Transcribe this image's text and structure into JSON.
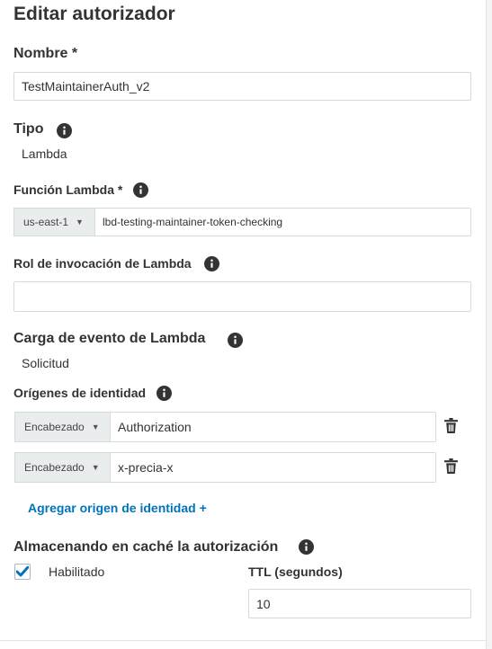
{
  "page": {
    "title": "Editar autorizador"
  },
  "nombre": {
    "label": "Nombre *",
    "value": "TestMaintainerAuth_v2"
  },
  "tipo": {
    "label": "Tipo",
    "value": "Lambda"
  },
  "funcion_lambda": {
    "label": "Función Lambda *",
    "region": "us-east-1",
    "value": "lbd-testing-maintainer-token-checking"
  },
  "rol_invocacion": {
    "label": "Rol de invocación de Lambda",
    "value": ""
  },
  "carga_evento": {
    "label": "Carga de evento de Lambda",
    "value": "Solicitud"
  },
  "origenes_identidad": {
    "label": "Orígenes de identidad",
    "rows": [
      {
        "type": "Encabezado",
        "value": "Authorization"
      },
      {
        "type": "Encabezado",
        "value": "x-precia-x"
      }
    ],
    "add_link": "Agregar origen de identidad +"
  },
  "cache": {
    "label": "Almacenando en caché la autorización",
    "enabled_label": "Habilitado",
    "enabled": true,
    "ttl_label": "TTL (segundos)",
    "ttl_value": "10"
  },
  "colors": {
    "accent": "#0073bb",
    "label": "#333333",
    "border": "#d5dbdb",
    "select_bg": "#eaeded"
  },
  "icons": {
    "info": "info-icon",
    "trash": "trash-icon",
    "check": "check-icon",
    "caret": "caret-down-icon"
  }
}
